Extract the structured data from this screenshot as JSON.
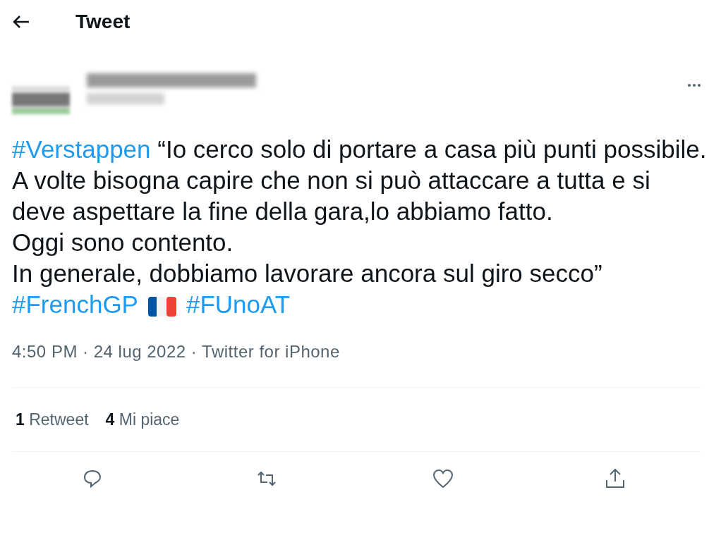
{
  "header": {
    "title": "Tweet"
  },
  "author": {
    "redacted": true
  },
  "body": [
    {
      "kind": "hashtag",
      "text": "#Verstappen"
    },
    {
      "kind": "text",
      "text": " “Io cerco solo di portare a casa più punti possibile.\nA volte bisogna capire che non si può attaccare a tutta e si deve aspettare la fine della gara,lo abbiamo fatto.\nOggi sono contento.\nIn generale, dobbiamo lavorare ancora sul giro secco”\n"
    },
    {
      "kind": "hashtag",
      "text": "#FrenchGP"
    },
    {
      "kind": "flag"
    },
    {
      "kind": "hashtag",
      "text": "#FUnoAT"
    }
  ],
  "meta": {
    "text": "4:50 PM · 24 lug 2022 · Twitter for iPhone"
  },
  "stats": [
    {
      "count": "1",
      "label": "Retweet"
    },
    {
      "count": "4",
      "label": "Mi piace"
    }
  ]
}
